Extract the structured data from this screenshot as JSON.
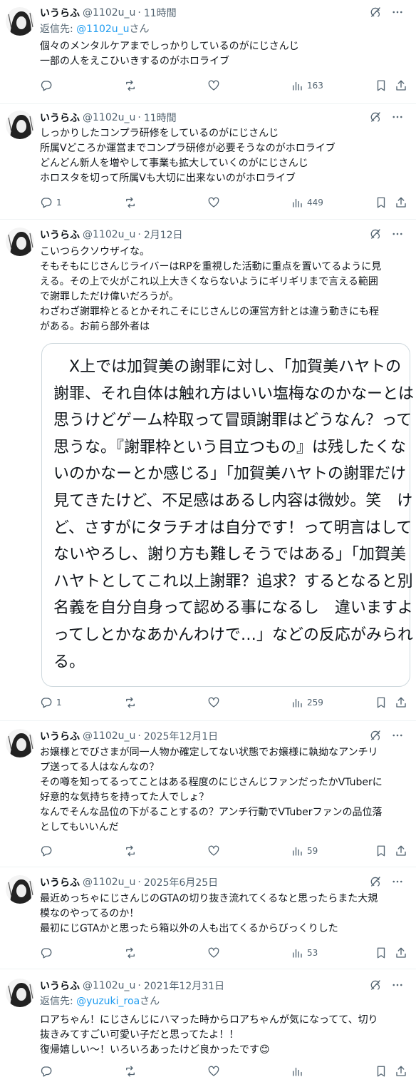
{
  "user": {
    "name": "いうらふ",
    "handle": "@1102u_u"
  },
  "tweets": [
    {
      "time": "11時間",
      "reply_prefix": "返信先:",
      "reply_link": "@1102u_u",
      "reply_suffix": "さん",
      "lines": [
        "個々のメンタルケアまでしっかりしているのがにじさんじ",
        "一部の人をえこひいきするのがホロライブ"
      ],
      "replies": "",
      "views": "163"
    },
    {
      "time": "11時間",
      "lines": [
        "しっかりしたコンプラ研修をしているのがにじさんじ",
        "所属Vどころか運営までコンプラ研修が必要そうなのがホロライブ",
        "どんどん新人を増やして事業も拡大していくのがにじさんじ",
        "ホロスタを切って所属Vも大切に出来ないのがホロライブ"
      ],
      "replies": "1",
      "views": "449"
    },
    {
      "time": "2月12日",
      "lines": [
        "こいつらクソウザイな。",
        "そもそもにじさんじライバーはRPを重視した活動に重点を置いてるように見",
        "える。その上で火がこれ以上大きくならないようにギリギリまで言える範囲",
        "で謝罪しただけ偉いだろうが。",
        "わざわざ謝罪枠とるとかそれこそにじさんじの運営方針とは違う動きにも程",
        "がある。お前ら部外者は"
      ],
      "quote_lines": [
        "　X上では加賀美の謝罪に対し、「加賀美ハヤトの",
        "謝罪、それ自体は触れ方はいい塩梅なのかなーとは",
        "思うけどゲーム枠取って冒頭謝罪はどうなん？って",
        "思うな。『謝罪枠という目立つもの』は残したくな",
        "いのかなーとか感じる」「加賀美ハヤトの謝罪だけ",
        "見てきたけど、不足感はあるし内容は微妙。笑　け",
        "ど、さすがにタラチオは自分です！って明言はして",
        "ないやろし、謝り方も難しそうではある」「加賀美",
        "ハヤトとしてこれ以上謝罪？追求？するとなると別",
        "名義を自分自身って認める事になるし　違いますよ",
        "ってしとかなあかんわけで…」などの反応がみられ",
        "る。"
      ],
      "replies": "1",
      "views": "259"
    },
    {
      "time": "2025年12月1日",
      "lines": [
        "お嬢様とでびさまが同一人物か確定してない状態でお嬢様に執拗なアンチリ",
        "プ送ってる人はなんなの？",
        "その噂を知ってるってことはある程度のにじさんじファンだったかVTuberに",
        "好意的な気持ちを持ってた人でしょ？",
        "なんでそんな品位の下がることするの？アンチ行動でVTuberファンの品位落",
        "としてもいいんだ"
      ],
      "replies": "",
      "views": "59"
    },
    {
      "time": "2025年6月25日",
      "lines": [
        "最近めっちゃにじさんじのGTAの切り抜き流れてくるなと思ったらまた大規",
        "模なのやってるのか！",
        "最初にじGTAかと思ったら箱以外の人も出てくるからびっくりした"
      ],
      "replies": "",
      "views": "53"
    },
    {
      "time": "2021年12月31日",
      "reply_prefix": "返信先:",
      "reply_link": "@yuzuki_roa",
      "reply_suffix": "さん",
      "lines": [
        "ロアちゃん！にじさんじにハマった時からロアちゃんが気になってて、切り",
        "抜きみてすごい可愛い子だと思ってたよ！！",
        "復帰嬉しい〜！いろいろあったけど良かったです😊"
      ],
      "replies": "",
      "views": ""
    }
  ],
  "icons": [
    "avatar",
    "grok-icon",
    "more-icon",
    "reply-icon",
    "retweet-icon",
    "like-icon",
    "views-icon",
    "bookmark-icon",
    "share-icon"
  ],
  "colors": {
    "text": "#0f1419",
    "secondary": "#536471",
    "link": "#1d9bf0",
    "border": "#cfd9de"
  }
}
